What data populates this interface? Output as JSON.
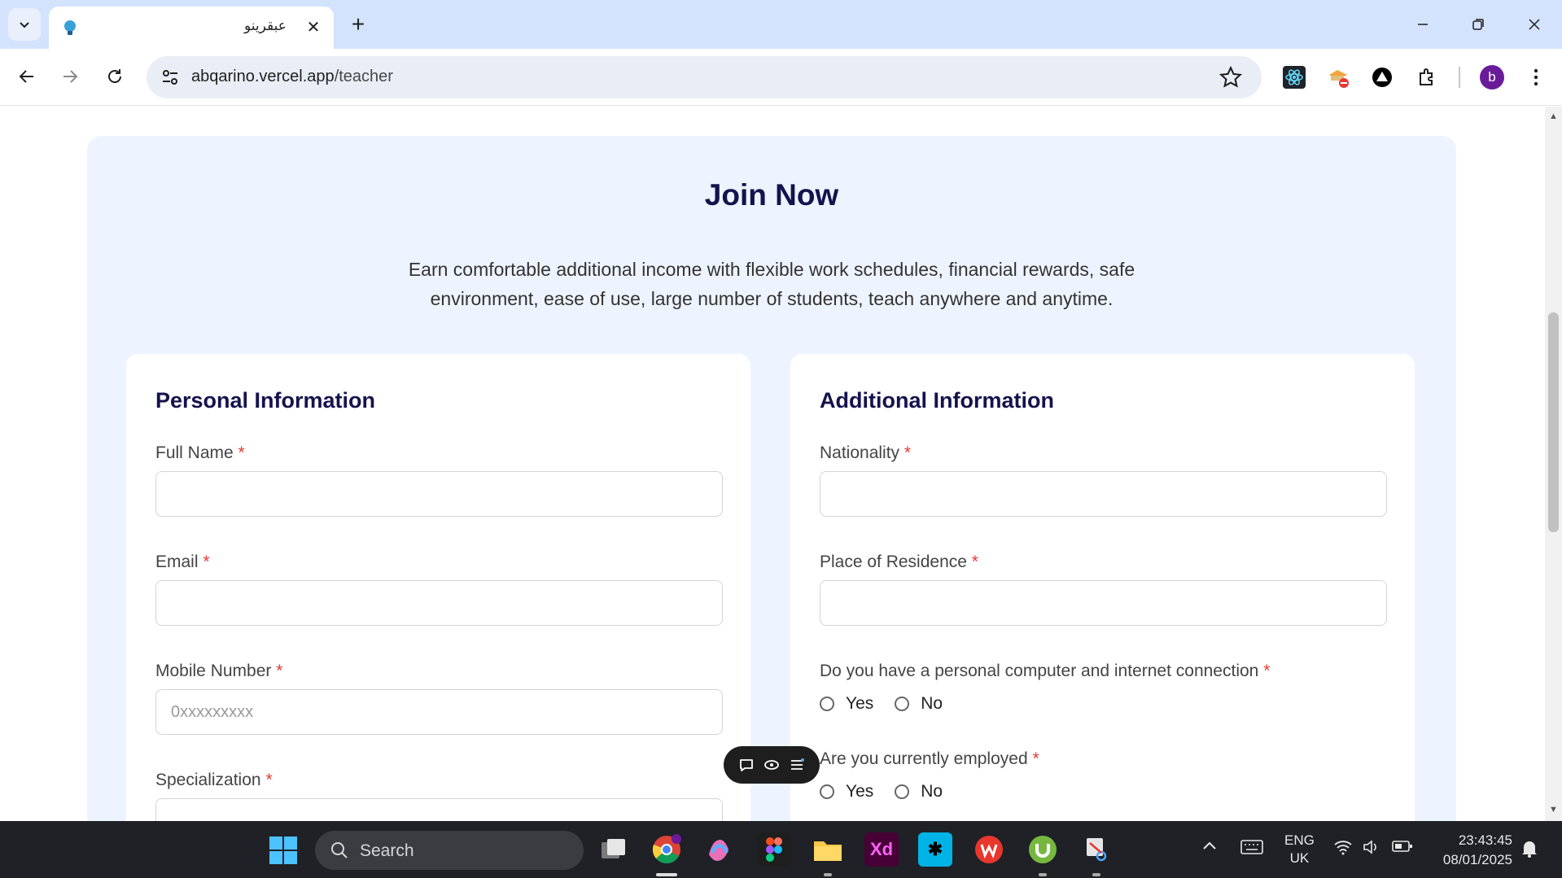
{
  "browser": {
    "tab_title": "عبقرينو",
    "url_host": "abqarino.vercel.app",
    "url_path": "/teacher",
    "profile_initial": "b"
  },
  "page": {
    "heading": "Join Now",
    "subtitle": "Earn comfortable additional income with flexible work schedules, financial rewards, safe environment, ease of use, large number of students, teach anywhere and anytime.",
    "required_mark": "*",
    "personal": {
      "title": "Personal Information",
      "full_name_label": "Full Name",
      "email_label": "Email",
      "mobile_label": "Mobile Number",
      "mobile_placeholder": "0xxxxxxxxx",
      "specialization_label": "Specialization"
    },
    "additional": {
      "title": "Additional Information",
      "nationality_label": "Nationality",
      "residence_label": "Place of Residence",
      "computer_question": "Do you have a personal computer and internet connection",
      "employed_question": "Are you currently employed",
      "yes": "Yes",
      "no": "No"
    }
  },
  "taskbar": {
    "search_text": "Search",
    "language": "ENG",
    "region": "UK",
    "time": "23:43:45",
    "date": "08/01/2025"
  }
}
